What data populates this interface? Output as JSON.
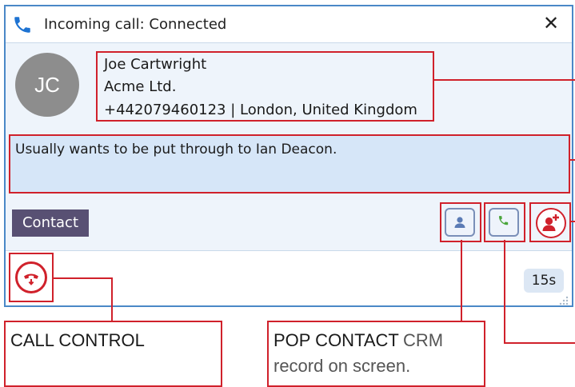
{
  "window": {
    "title": "Incoming call: Connected",
    "close_label": "✕"
  },
  "caller": {
    "initials": "JC",
    "name": "Joe Cartwright",
    "company": "Acme Ltd.",
    "phone_location": "+442079460123 | London, United Kingdom"
  },
  "notes": {
    "text": "Usually wants to be put through to Ian Deacon."
  },
  "actions": {
    "contact_label": "Contact"
  },
  "footer": {
    "timer": "15s"
  },
  "callouts": {
    "call_control": {
      "title": "CALL CONTROL"
    },
    "pop_contact": {
      "title": "POP CONTACT",
      "desc_inline": "CRM",
      "desc_line2": "record on screen."
    }
  },
  "colors": {
    "accent_red": "#d0212b",
    "window_border": "#4a88c7",
    "contact_button": "#585073",
    "notes_bg": "#d6e6f8"
  },
  "icons": [
    "phone-icon",
    "close-icon",
    "person-icon",
    "phone-call-icon",
    "add-contact-icon",
    "hangup-icon",
    "resize-grip-icon"
  ]
}
